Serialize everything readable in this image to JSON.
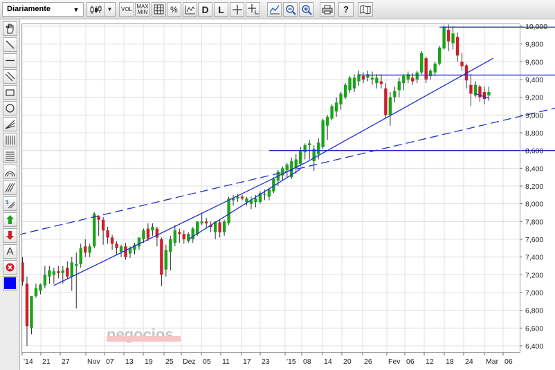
{
  "toolbar": {
    "period_select": "Diariamente",
    "vol_label": "VOL",
    "maxmin_label": "MAX MIN",
    "percent_label": "%",
    "d_label": "D",
    "l_label": "L",
    "help_label": "?"
  },
  "sidebar": {
    "text_tool_label": "A",
    "color_swatch": "#0000ff"
  },
  "colors": {
    "up": "#1aa31a",
    "down": "#cc1f2c",
    "line": "#1f2fcf",
    "grid": "#d9d9d9"
  },
  "chart_data": {
    "type": "candlestick",
    "ylim": [
      6400,
      10000
    ],
    "yticks": [
      "10,000",
      "9,800",
      "9,600",
      "9,400",
      "9,200",
      "9,000",
      "8,800",
      "8,600",
      "8,400",
      "8,200",
      "8,000",
      "7,800",
      "7,600",
      "7,400",
      "7,200",
      "7,000",
      "6,800",
      "6,600",
      "6,400"
    ],
    "xticks": [
      "'14",
      "21",
      "27",
      "Nov",
      "07",
      "13",
      "19",
      "25",
      "Dez",
      "05",
      "11",
      "17",
      "23",
      "'15",
      "08",
      "14",
      "20",
      "26",
      "Fev",
      "06",
      "12",
      "18",
      "24",
      "Mar",
      "06"
    ],
    "watermark": "negocios",
    "candles": [
      [
        7340,
        7400,
        7080,
        7120
      ],
      [
        7100,
        7180,
        6400,
        6620
      ],
      [
        6600,
        6950,
        6530,
        6960
      ],
      [
        6960,
        7100,
        6940,
        7050
      ],
      [
        7020,
        7100,
        6980,
        7090
      ],
      [
        7080,
        7300,
        7050,
        7200
      ],
      [
        7180,
        7300,
        7100,
        7250
      ],
      [
        7200,
        7280,
        7100,
        7240
      ],
      [
        7240,
        7300,
        7160,
        7220
      ],
      [
        7220,
        7300,
        7100,
        7250
      ],
      [
        7280,
        7350,
        7150,
        7180
      ],
      [
        7180,
        7400,
        7020,
        7340
      ],
      [
        7300,
        7450,
        6820,
        7320
      ],
      [
        7320,
        7550,
        7280,
        7500
      ],
      [
        7520,
        7600,
        7400,
        7450
      ],
      [
        7450,
        7550,
        7400,
        7520
      ],
      [
        7520,
        7910,
        7500,
        7890
      ],
      [
        7860,
        7870,
        7640,
        7820
      ],
      [
        7820,
        7850,
        7540,
        7700
      ],
      [
        7700,
        7740,
        7550,
        7620
      ],
      [
        7620,
        7650,
        7480,
        7550
      ],
      [
        7550,
        7580,
        7420,
        7500
      ],
      [
        7460,
        7540,
        7400,
        7520
      ],
      [
        7520,
        7560,
        7370,
        7400
      ],
      [
        7440,
        7520,
        7390,
        7500
      ],
      [
        7480,
        7560,
        7430,
        7540
      ],
      [
        7520,
        7620,
        7480,
        7620
      ],
      [
        7600,
        7720,
        7560,
        7700
      ],
      [
        7720,
        7780,
        7580,
        7610
      ],
      [
        7700,
        7780,
        7640,
        7740
      ],
      [
        7720,
        7740,
        7520,
        7620
      ],
      [
        7600,
        7620,
        7070,
        7200
      ],
      [
        7260,
        7540,
        7180,
        7480
      ],
      [
        7460,
        7640,
        7250,
        7600
      ],
      [
        7560,
        7760,
        7520,
        7700
      ],
      [
        7680,
        7720,
        7560,
        7660
      ],
      [
        7660,
        7700,
        7550,
        7600
      ],
      [
        7580,
        7680,
        7560,
        7660
      ],
      [
        7600,
        7740,
        7560,
        7720
      ],
      [
        7660,
        7800,
        7640,
        7800
      ],
      [
        7780,
        7900,
        7760,
        7800
      ],
      [
        7800,
        7840,
        7720,
        7780
      ],
      [
        7760,
        7800,
        7680,
        7740
      ],
      [
        7680,
        7800,
        7600,
        7800
      ],
      [
        7790,
        7820,
        7620,
        7680
      ],
      [
        7680,
        7820,
        7640,
        7800
      ],
      [
        7780,
        8080,
        7760,
        8060
      ],
      [
        8040,
        8100,
        7980,
        8060
      ],
      [
        8060,
        8110,
        8020,
        8080
      ],
      [
        8080,
        8100,
        8040,
        8060
      ],
      [
        8020,
        8080,
        7980,
        8060
      ],
      [
        8000,
        8080,
        7940,
        8040
      ],
      [
        8020,
        8100,
        7960,
        8060
      ],
      [
        8020,
        8140,
        8000,
        8120
      ],
      [
        8100,
        8160,
        8040,
        8110
      ],
      [
        8080,
        8180,
        8040,
        8160
      ],
      [
        8140,
        8300,
        8120,
        8280
      ],
      [
        8260,
        8380,
        8200,
        8360
      ],
      [
        8320,
        8420,
        8260,
        8400
      ],
      [
        8380,
        8460,
        8300,
        8440
      ],
      [
        8300,
        8520,
        8280,
        8480
      ],
      [
        8400,
        8560,
        8340,
        8500
      ],
      [
        8450,
        8640,
        8420,
        8600
      ],
      [
        8580,
        8680,
        8500,
        8660
      ],
      [
        8660,
        8720,
        8500,
        8680
      ],
      [
        8480,
        8660,
        8370,
        8620
      ],
      [
        8560,
        8740,
        8500,
        8690
      ],
      [
        8640,
        8960,
        8620,
        8940
      ],
      [
        8880,
        9000,
        8720,
        8980
      ],
      [
        8960,
        9120,
        8940,
        9100
      ],
      [
        9040,
        9200,
        8980,
        9140
      ],
      [
        9120,
        9260,
        9060,
        9240
      ],
      [
        9200,
        9360,
        9180,
        9340
      ],
      [
        9280,
        9440,
        9250,
        9420
      ],
      [
        9300,
        9460,
        9260,
        9420
      ],
      [
        9380,
        9500,
        9330,
        9460
      ],
      [
        9440,
        9480,
        9360,
        9400
      ],
      [
        9420,
        9500,
        9380,
        9460
      ],
      [
        9400,
        9490,
        9340,
        9420
      ],
      [
        9360,
        9460,
        9300,
        9420
      ],
      [
        9380,
        9460,
        9300,
        9350
      ],
      [
        9300,
        9360,
        8960,
        9000
      ],
      [
        9000,
        9260,
        8880,
        9200
      ],
      [
        9200,
        9320,
        9140,
        9270
      ],
      [
        9280,
        9420,
        9200,
        9380
      ],
      [
        9360,
        9460,
        9280,
        9440
      ],
      [
        9400,
        9490,
        9360,
        9460
      ],
      [
        9420,
        9470,
        9340,
        9380
      ],
      [
        9400,
        9500,
        9360,
        9480
      ],
      [
        9480,
        9720,
        9460,
        9700
      ],
      [
        9640,
        9660,
        9360,
        9400
      ],
      [
        9440,
        9520,
        9400,
        9500
      ],
      [
        9480,
        9600,
        9440,
        9580
      ],
      [
        9580,
        9780,
        9560,
        9760
      ],
      [
        9750,
        10010,
        9740,
        9990
      ],
      [
        9960,
        10020,
        9720,
        9830
      ],
      [
        9810,
        10000,
        9740,
        9920
      ],
      [
        9880,
        9930,
        9600,
        9670
      ],
      [
        9600,
        9700,
        9500,
        9550
      ],
      [
        9560,
        9580,
        9300,
        9390
      ],
      [
        9340,
        9460,
        9100,
        9240
      ],
      [
        9220,
        9380,
        9200,
        9340
      ],
      [
        9320,
        9340,
        9150,
        9200
      ],
      [
        9260,
        9320,
        9120,
        9180
      ],
      [
        9220,
        9320,
        9160,
        9260
      ]
    ],
    "lines": [
      {
        "style": "solid",
        "from": [
          7,
          7080
        ],
        "to": [
          63,
          8460
        ]
      },
      {
        "style": "solid",
        "from": [
          63,
          8460
        ],
        "to": [
          105,
          9640
        ]
      },
      {
        "style": "solid",
        "from": [
          37,
          7600
        ],
        "to": [
          62,
          8390
        ]
      },
      {
        "style": "dashed",
        "from": [
          -1,
          7650
        ],
        "to": [
          129,
          9200
        ]
      },
      {
        "style": "solid",
        "from": [
          55,
          8600
        ],
        "to": [
          124,
          8600
        ]
      },
      {
        "style": "solid",
        "from": [
          75,
          9450
        ],
        "to": [
          124,
          9450
        ]
      },
      {
        "style": "solid",
        "from": [
          93,
          9990
        ],
        "to": [
          124,
          9990
        ]
      },
      {
        "style": "solid",
        "from": [
          101,
          9240
        ],
        "to": [
          104,
          9190
        ]
      }
    ]
  }
}
